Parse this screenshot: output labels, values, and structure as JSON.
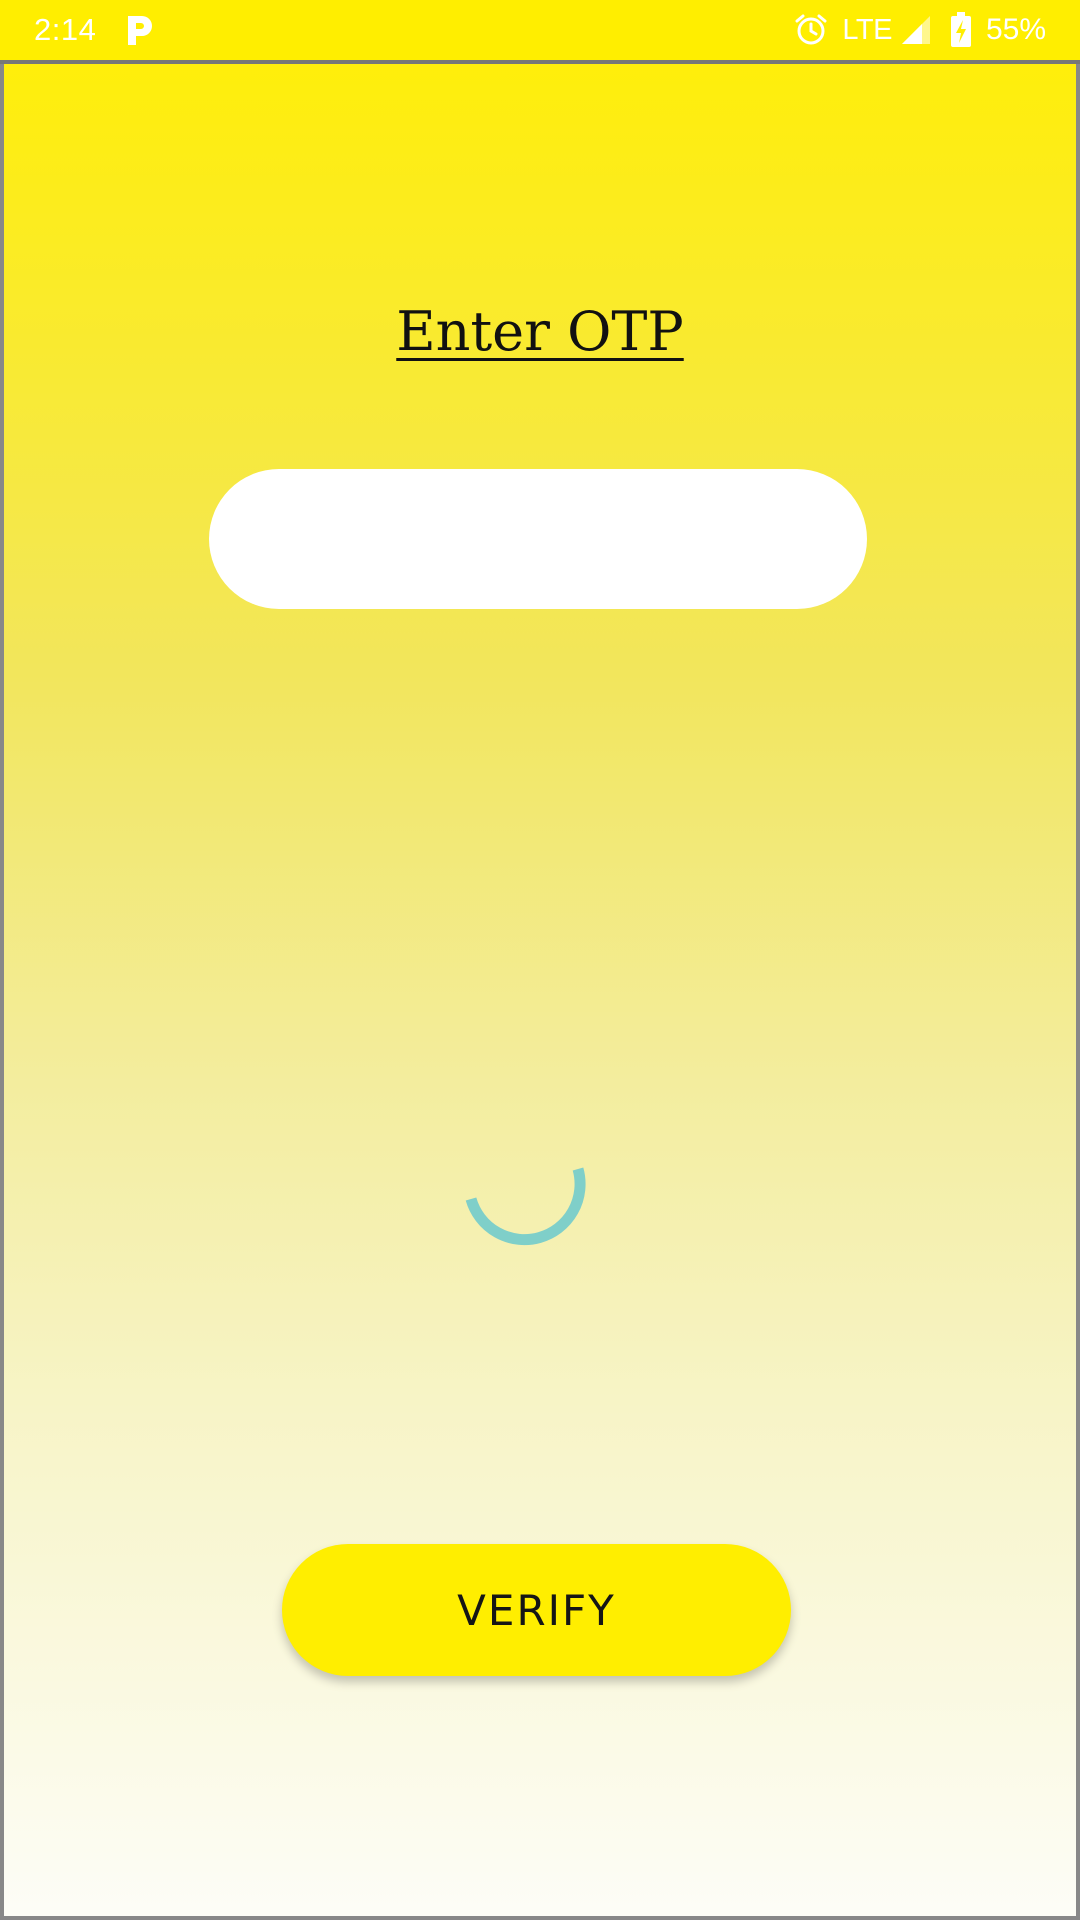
{
  "status_bar": {
    "time": "2:14",
    "app_icon": "parking-p-icon",
    "alarm_icon": "alarm-icon",
    "network": "LTE",
    "signal_icon": "cellular-signal-icon",
    "battery_icon": "battery-charging-icon",
    "battery_percent": "55%",
    "background_color": "#ffee00"
  },
  "otp_screen": {
    "title": "Enter OTP",
    "otp_field": {
      "value": "",
      "placeholder": ""
    },
    "loading_indicator_color": "#7fcfc9",
    "verify_label": "VERIFY",
    "accent_color": "#ffee00"
  }
}
